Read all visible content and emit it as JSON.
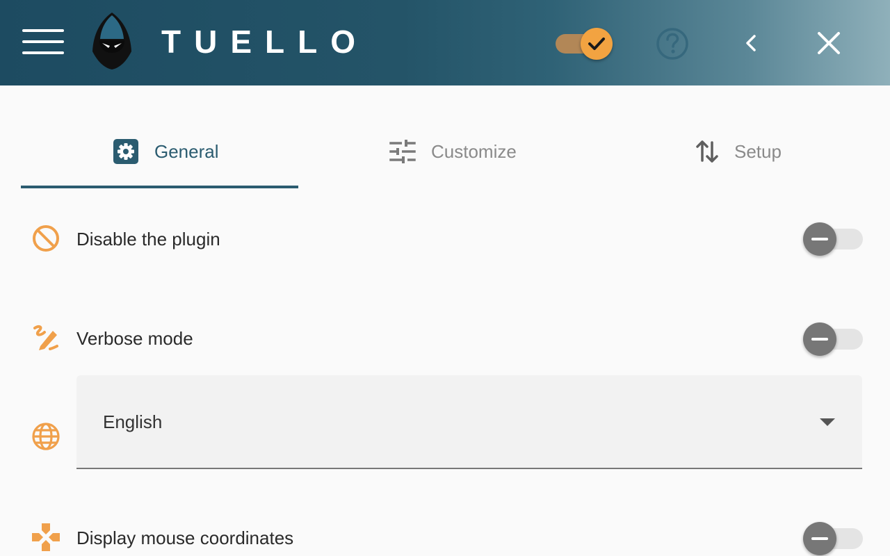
{
  "app": {
    "brand": "TUELLO"
  },
  "header": {
    "menu_icon": "hamburger-icon",
    "logo_icon": "hooded-ninja-logo",
    "master_toggle": {
      "state": "on",
      "icon": "check-icon"
    },
    "help_icon": "question-circle-icon",
    "back_icon": "chevron-left-icon",
    "close_icon": "close-icon"
  },
  "tabs": [
    {
      "label": "General",
      "icon": "gear-icon",
      "active": true
    },
    {
      "label": "Customize",
      "icon": "sliders-icon",
      "active": false
    },
    {
      "label": "Setup",
      "icon": "swap-vertical-icon",
      "active": false
    }
  ],
  "settings": {
    "disable_plugin": {
      "label": "Disable the plugin",
      "icon": "block-icon",
      "state": "off"
    },
    "verbose_mode": {
      "label": "Verbose mode",
      "icon": "draw-icon",
      "state": "off"
    },
    "language": {
      "value": "English",
      "icon": "globe-icon"
    },
    "mouse_coordinates": {
      "label": "Display mouse coordinates",
      "icon": "gamepad-icon",
      "state": "off"
    }
  },
  "colors": {
    "header_dark": "#1d4b61",
    "header_light": "#8fb0ba",
    "accent_teal": "#2b5c70",
    "accent_orange": "#f2a341",
    "icon_orange": "#f0a04b",
    "switch_knob_off": "#777777"
  }
}
